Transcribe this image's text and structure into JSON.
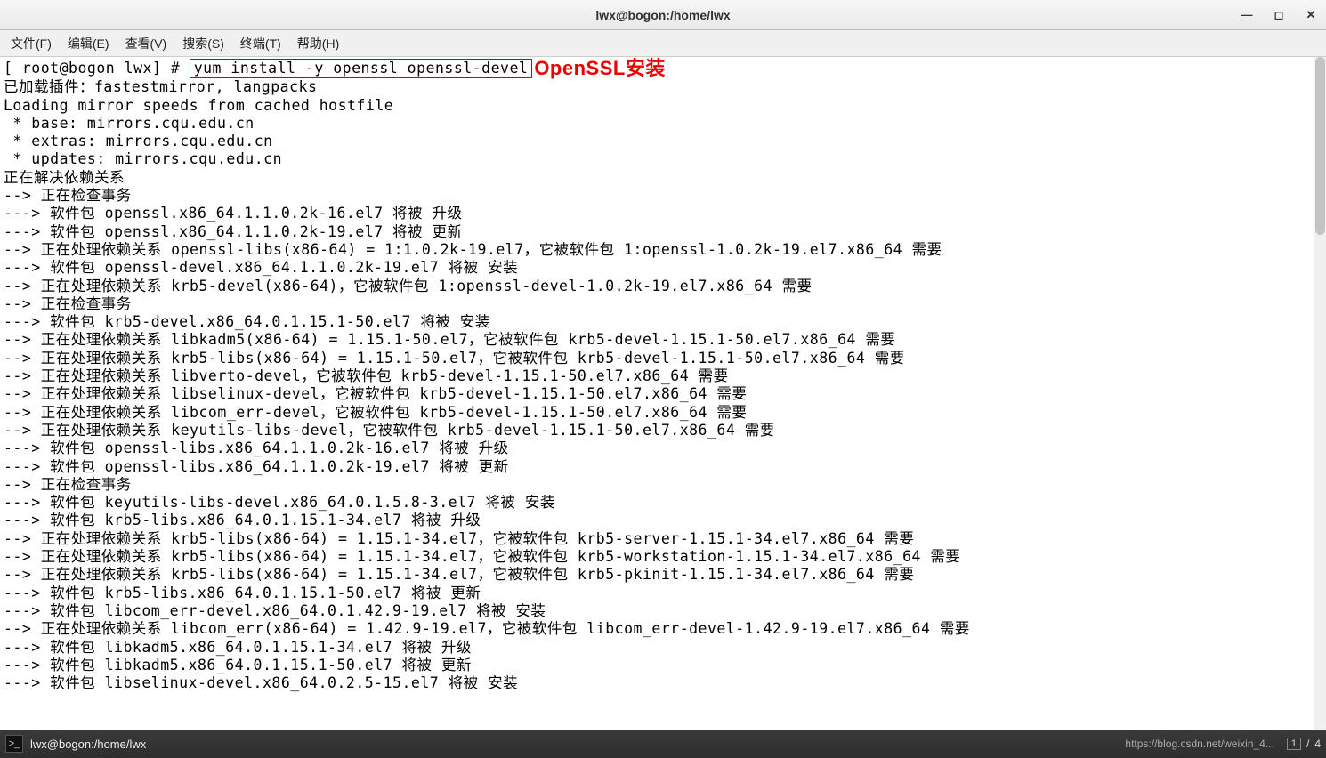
{
  "titlebar": {
    "title": "lwx@bogon:/home/lwx",
    "minimize": "—",
    "maximize": "◻",
    "close": "✕"
  },
  "menubar": {
    "file": "文件(F)",
    "edit": "编辑(E)",
    "view": "查看(V)",
    "search": "搜索(S)",
    "terminal": "终端(T)",
    "help": "帮助(H)"
  },
  "prompt": {
    "prefix": "[ root@bogon lwx] # ",
    "command": "yum install -y openssl openssl-devel",
    "annotation": "OpenSSL安装"
  },
  "output": [
    "已加载插件：fastestmirror, langpacks",
    "Loading mirror speeds from cached hostfile",
    " * base: mirrors.cqu.edu.cn",
    " * extras: mirrors.cqu.edu.cn",
    " * updates: mirrors.cqu.edu.cn",
    "正在解决依赖关系",
    "--> 正在检查事务",
    "---> 软件包 openssl.x86_64.1.1.0.2k-16.el7 将被 升级",
    "---> 软件包 openssl.x86_64.1.1.0.2k-19.el7 将被 更新",
    "--> 正在处理依赖关系 openssl-libs(x86-64) = 1:1.0.2k-19.el7，它被软件包 1:openssl-1.0.2k-19.el7.x86_64 需要",
    "---> 软件包 openssl-devel.x86_64.1.1.0.2k-19.el7 将被 安装",
    "--> 正在处理依赖关系 krb5-devel(x86-64)，它被软件包 1:openssl-devel-1.0.2k-19.el7.x86_64 需要",
    "--> 正在检查事务",
    "---> 软件包 krb5-devel.x86_64.0.1.15.1-50.el7 将被 安装",
    "--> 正在处理依赖关系 libkadm5(x86-64) = 1.15.1-50.el7，它被软件包 krb5-devel-1.15.1-50.el7.x86_64 需要",
    "--> 正在处理依赖关系 krb5-libs(x86-64) = 1.15.1-50.el7，它被软件包 krb5-devel-1.15.1-50.el7.x86_64 需要",
    "--> 正在处理依赖关系 libverto-devel，它被软件包 krb5-devel-1.15.1-50.el7.x86_64 需要",
    "--> 正在处理依赖关系 libselinux-devel，它被软件包 krb5-devel-1.15.1-50.el7.x86_64 需要",
    "--> 正在处理依赖关系 libcom_err-devel，它被软件包 krb5-devel-1.15.1-50.el7.x86_64 需要",
    "--> 正在处理依赖关系 keyutils-libs-devel，它被软件包 krb5-devel-1.15.1-50.el7.x86_64 需要",
    "---> 软件包 openssl-libs.x86_64.1.1.0.2k-16.el7 将被 升级",
    "---> 软件包 openssl-libs.x86_64.1.1.0.2k-19.el7 将被 更新",
    "--> 正在检查事务",
    "---> 软件包 keyutils-libs-devel.x86_64.0.1.5.8-3.el7 将被 安装",
    "---> 软件包 krb5-libs.x86_64.0.1.15.1-34.el7 将被 升级",
    "--> 正在处理依赖关系 krb5-libs(x86-64) = 1.15.1-34.el7，它被软件包 krb5-server-1.15.1-34.el7.x86_64 需要",
    "--> 正在处理依赖关系 krb5-libs(x86-64) = 1.15.1-34.el7，它被软件包 krb5-workstation-1.15.1-34.el7.x86_64 需要",
    "--> 正在处理依赖关系 krb5-libs(x86-64) = 1.15.1-34.el7，它被软件包 krb5-pkinit-1.15.1-34.el7.x86_64 需要",
    "---> 软件包 krb5-libs.x86_64.0.1.15.1-50.el7 将被 更新",
    "---> 软件包 libcom_err-devel.x86_64.0.1.42.9-19.el7 将被 安装",
    "--> 正在处理依赖关系 libcom_err(x86-64) = 1.42.9-19.el7，它被软件包 libcom_err-devel-1.42.9-19.el7.x86_64 需要",
    "---> 软件包 libkadm5.x86_64.0.1.15.1-34.el7 将被 升级",
    "---> 软件包 libkadm5.x86_64.0.1.15.1-50.el7 将被 更新",
    "---> 软件包 libselinux-devel.x86_64.0.2.5-15.el7 将被 安装"
  ],
  "taskbar": {
    "app_icon_glyph": ">_",
    "app_label": "lwx@bogon:/home/lwx",
    "watermark": "https://blog.csdn.net/weixin_4...",
    "workspace_current": "1",
    "workspace_total": "4"
  }
}
